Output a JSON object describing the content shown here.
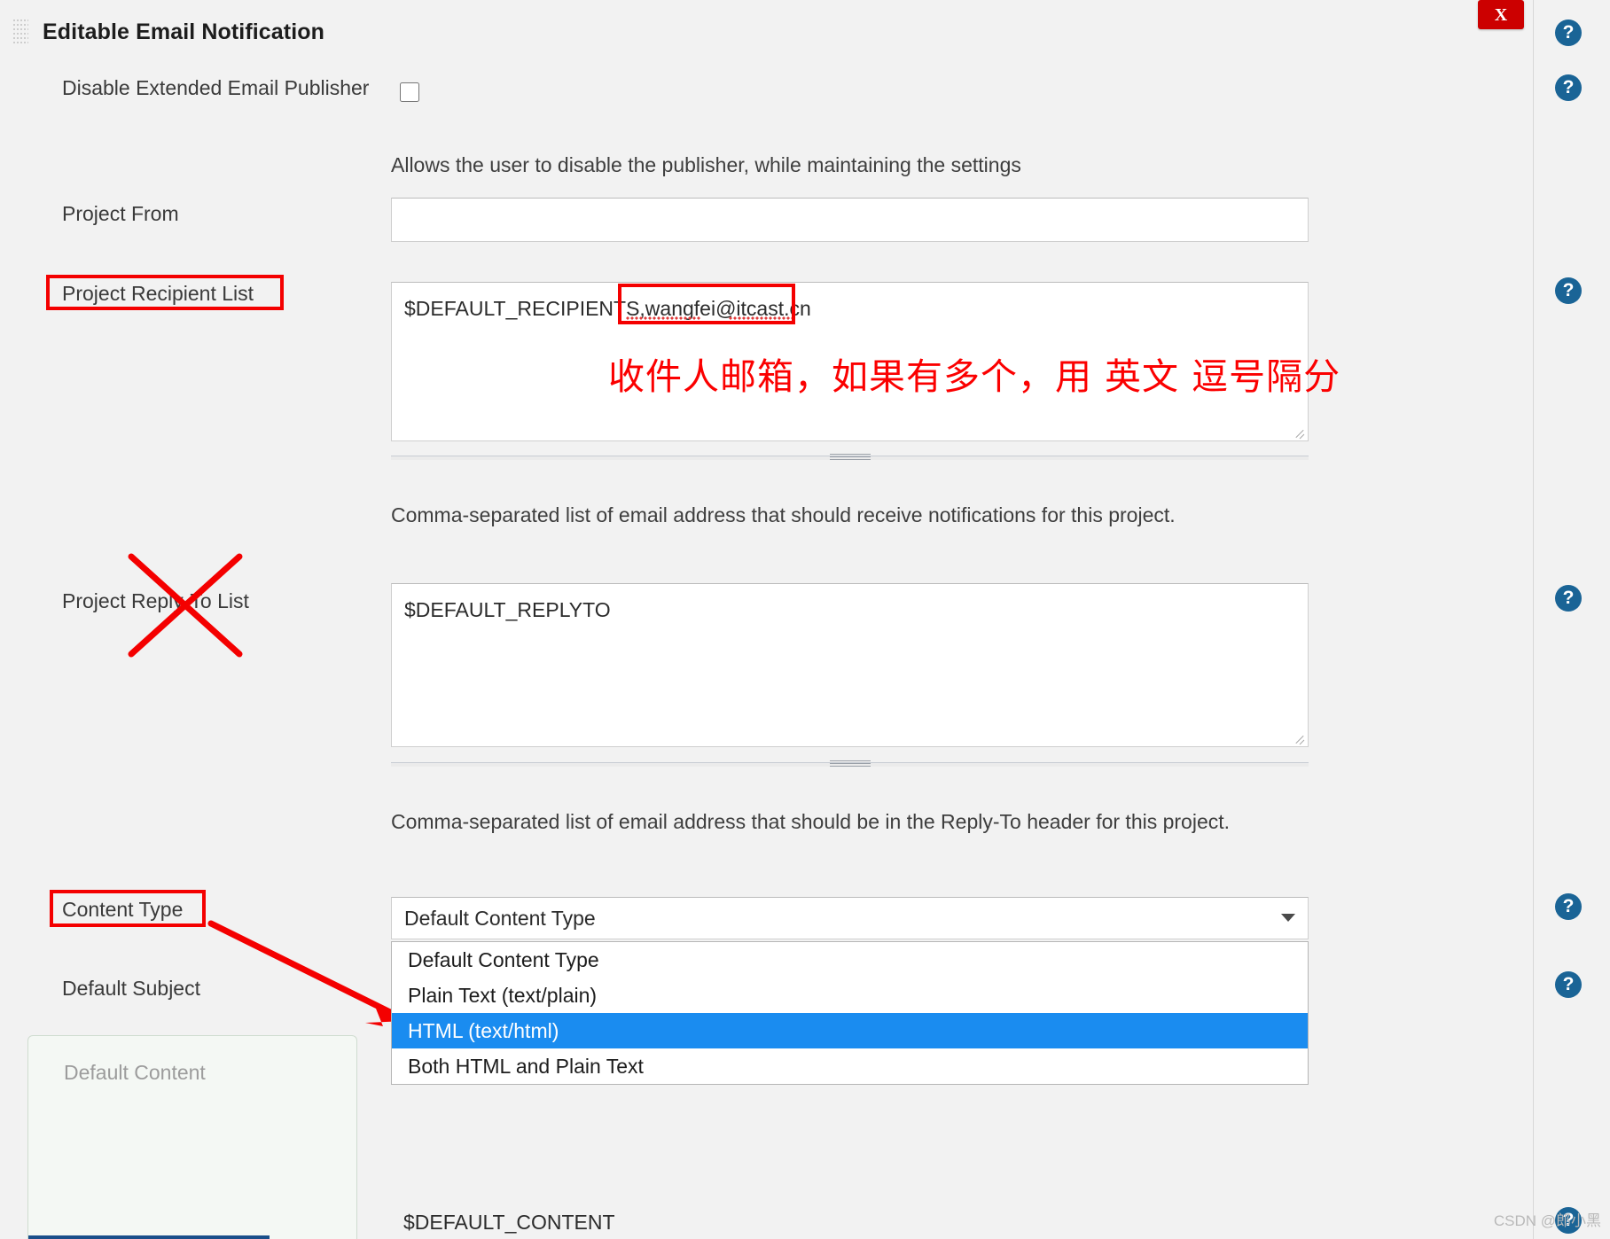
{
  "panel": {
    "title": "Editable Email Notification",
    "close_label": "X",
    "help_icon": "?"
  },
  "fields": {
    "disable_publisher": {
      "label": "Disable Extended Email Publisher",
      "checked": false,
      "help": "Allows the user to disable the publisher, while maintaining the settings"
    },
    "project_from": {
      "label": "Project From",
      "value": "",
      "placeholder": ""
    },
    "project_recipient_list": {
      "label": "Project Recipient List",
      "value": "$DEFAULT_RECIPIENTS,wangfei@itcast.cn",
      "help": "Comma-separated list of email address that should receive notifications for this project."
    },
    "project_reply_to_list": {
      "label": "Project Reply-To List",
      "value": "$DEFAULT_REPLYTO",
      "help": "Comma-separated list of email address that should be in the Reply-To header for this project."
    },
    "content_type": {
      "label": "Content Type",
      "selected": "Default Content Type",
      "options": [
        "Default Content Type",
        "Plain Text (text/plain)",
        "HTML (text/html)",
        "Both HTML and Plain Text"
      ],
      "highlighted": "HTML (text/html)"
    },
    "default_subject": {
      "label": "Default Subject"
    },
    "default_content": {
      "label": "Default Content",
      "value": "$DEFAULT_CONTENT"
    }
  },
  "annotations": {
    "chinese_note": "收件人邮箱，如果有多个，用 英文 逗号隔分",
    "accent_color": "#f40000",
    "highlight_color": "#1a8cf0",
    "close_color": "#cc0000",
    "help_color": "#1a6496"
  },
  "watermark": {
    "text": "CSDN @郎小黑"
  }
}
